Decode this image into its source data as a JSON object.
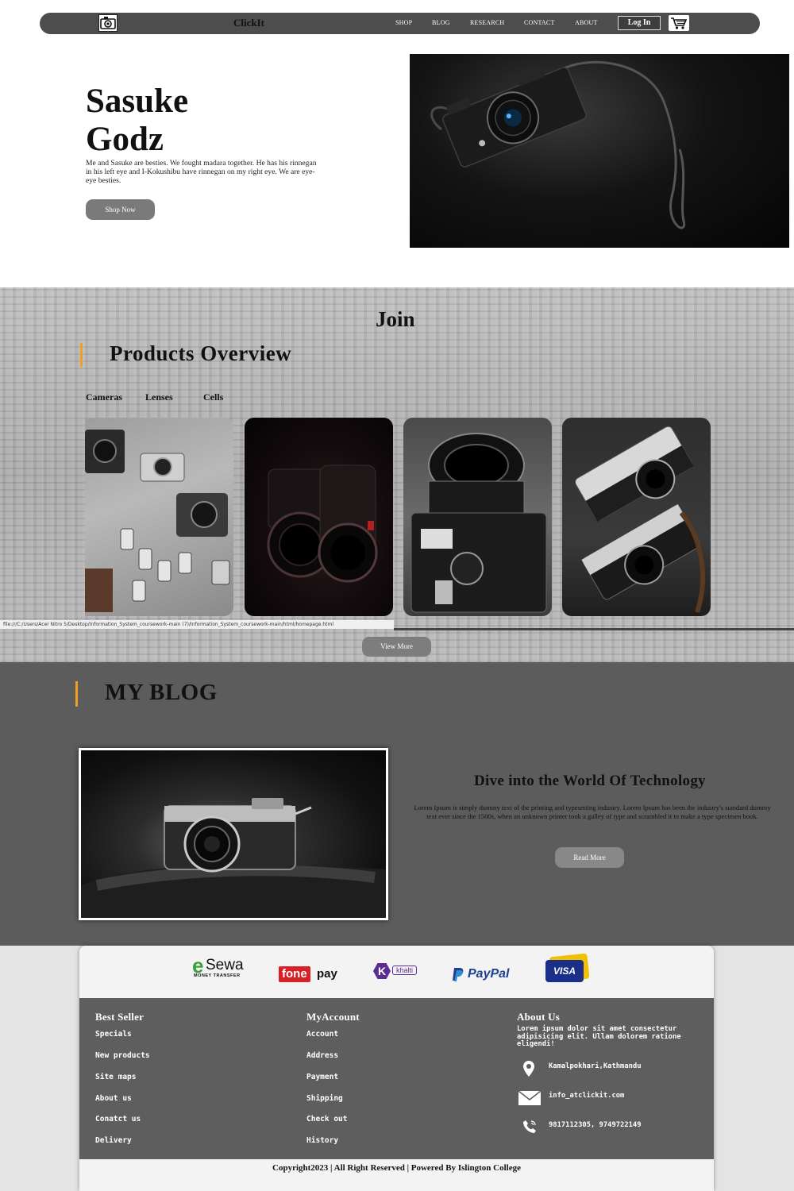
{
  "nav": {
    "brand": "ClickIt",
    "links": [
      "SHOP",
      "BLOG",
      "RESEARCH",
      "CONTACT",
      "ABOUT"
    ],
    "login_label": "Log In",
    "logo_icon": "camera-icon",
    "cart_icon": "cart-icon"
  },
  "hero": {
    "title_line1": "Sasuke",
    "title_line2": "Godz",
    "description": "Me and Sasuke are besties. We fought madara together. He has his rinnegan in his left eye and I-Kokushibu have rinnegan on my right eye. We are eye-eye besties.",
    "button_label": "Shop Now"
  },
  "products": {
    "join": "Join",
    "heading": "Products Overview",
    "tabs": [
      "Cameras",
      "Lenses",
      "Cells"
    ],
    "status_url": "file:///C:/Users/Acer Nitro 5/Desktop/Information_System_coursework-main (7)/Information_System_coursework-main/html/homepage.html",
    "button_label": "View More"
  },
  "blog": {
    "heading": "MY BLOG",
    "post_title": "Dive into the World Of Technology",
    "post_text": "Lorem Ipsum is simply dummy text of the printing and typesetting industry. Lorem Ipsum has been the industry's standard dummy text ever since the 1500s, when an unknown printer took a galley of type and scrambled it to make a type specimen book.",
    "button_label": "Read More"
  },
  "payments": {
    "esewa_main": "Sewa",
    "esewa_e": "e",
    "esewa_sub": "MONEY TRANSFER",
    "fonepay_a": "fone",
    "fonepay_b": "pay",
    "khalti_k": "K",
    "khalti": "khalti",
    "paypal": "PayPal",
    "visa": "VISA"
  },
  "footer": {
    "best_seller": {
      "title": "Best Seller",
      "links": [
        "Specials",
        "New products",
        "Site maps",
        "About us",
        "Conatct us",
        "Delivery"
      ]
    },
    "my_account": {
      "title": "MyAccount",
      "links": [
        "Account",
        "Address",
        "Payment",
        "Shipping",
        "Check out",
        "History"
      ]
    },
    "about": {
      "title": "About Us",
      "text": "Lorem ipsum dolor sit amet consectetur adipisicing elit. Ullam dolorem ratione eligendi!",
      "address": "Kamalpokhari,Kathmandu",
      "email": "info_atclickit.com",
      "phone": "9817112305, 9749722149"
    },
    "copyright": "Copyright2023 | All Right Reserved | Powered By Islington College"
  },
  "colors": {
    "accent": "#f0a020",
    "nav_bg": "#4d4d4d",
    "blog_bg": "#5c5c5c",
    "hero_bg": "#e5e3dd"
  }
}
